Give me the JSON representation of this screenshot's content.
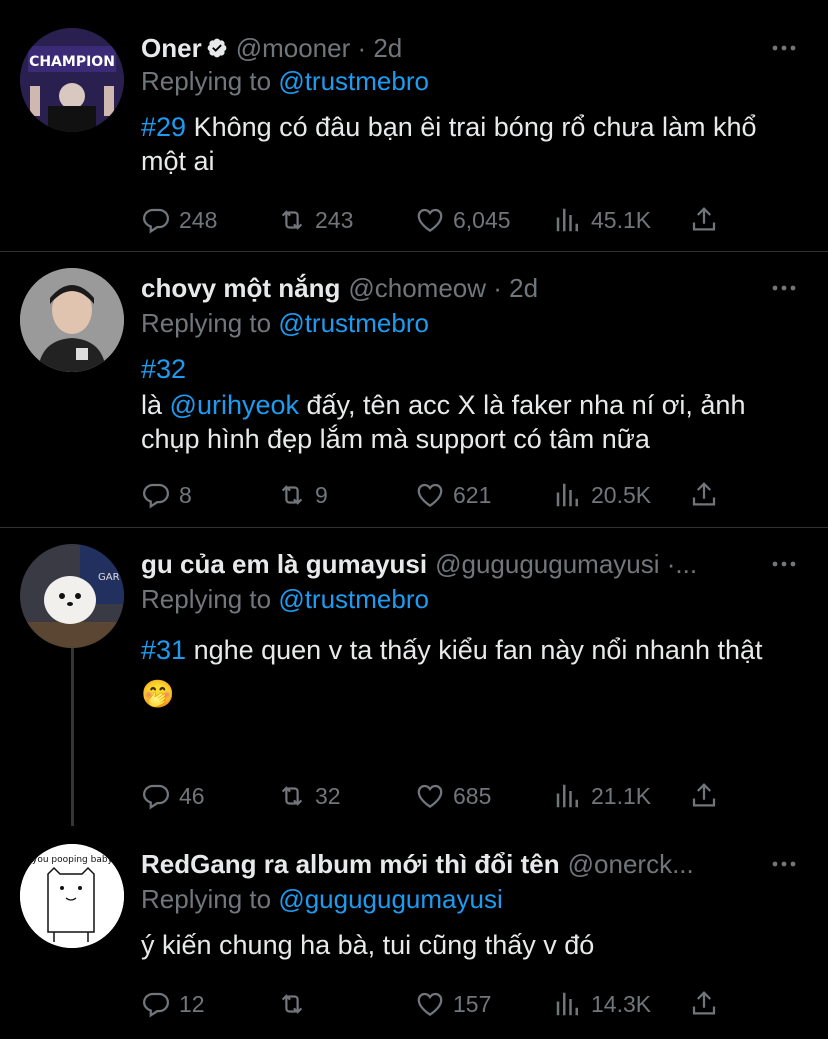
{
  "tweets": [
    {
      "name": "Oner",
      "verified": true,
      "handle": "@mooner · 2d",
      "replying_prefix": "Replying to",
      "replying_to": "@trustmebro",
      "hashtag": "#29",
      "text": " Không có đâu bạn êi trai bóng rổ chưa làm khổ một ai",
      "replies": "248",
      "retweets": "243",
      "likes": "6,045",
      "views": "45.1K",
      "avatar_text": "CHAMPION"
    },
    {
      "name": "chovy một nắng",
      "handle": "@chomeow · 2d",
      "replying_prefix": "Replying to",
      "replying_to": "@trustmebro",
      "hashtag": "#32",
      "text_pre": "là ",
      "mention": "@urihyeok",
      "text_post": " đấy, tên acc X là faker nha ní ơi, ảnh chụp hình đẹp lắm mà support có tâm nữa",
      "replies": "8",
      "retweets": "9",
      "likes": "621",
      "views": "20.5K"
    },
    {
      "name": "gu của em là gumayusi",
      "handle": "@gugugugumayusi ·...",
      "replying_prefix": "Replying to",
      "replying_to": "@trustmebro",
      "hashtag": "#31",
      "text": " nghe quen v ta thấy kiểu fan này nổi nhanh thật 🤭",
      "replies": "46",
      "retweets": "32",
      "likes": "685",
      "views": "21.1K"
    },
    {
      "name": "RedGang ra album mới thì đổi tên",
      "handle": "@onerck...",
      "replying_prefix": "Replying to",
      "replying_to": "@gugugugumayusi",
      "text": "ý kiến chung ha bà, tui cũng thấy v đó",
      "replies": "12",
      "retweets": "",
      "likes": "157",
      "views": "14.3K",
      "avatar_text": "you pooping baby"
    }
  ],
  "colors": {
    "background": "#000000",
    "text": "#e7e9ea",
    "muted": "#71767b",
    "accent": "#1d9bf0",
    "divider": "#2f3336"
  },
  "icons": {
    "reply": "reply-icon",
    "retweet": "retweet-icon",
    "like": "heart-icon",
    "views": "views-icon",
    "share": "share-icon",
    "more": "more-icon",
    "verified": "verified-badge-icon"
  }
}
